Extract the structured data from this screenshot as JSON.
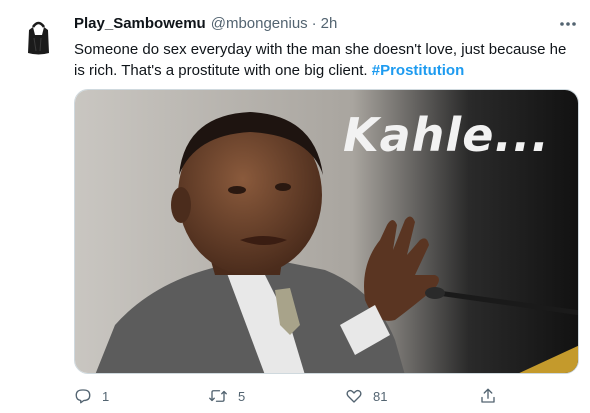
{
  "tweet": {
    "display_name": "Play_Sambowemu",
    "handle": "@mbongenius",
    "separator": "·",
    "time": "2h",
    "text": "Someone do sex everyday with the man she doesn't love, just because he is rich. That's a prostitute with one big client. ",
    "hashtag": "#Prostitution",
    "media_caption": "Kahle...",
    "colors": {
      "hashtag": "#1d9bf0",
      "secondary_text": "#536471"
    }
  },
  "actions": {
    "reply_count": "1",
    "retweet_count": "5",
    "like_count": "81"
  }
}
